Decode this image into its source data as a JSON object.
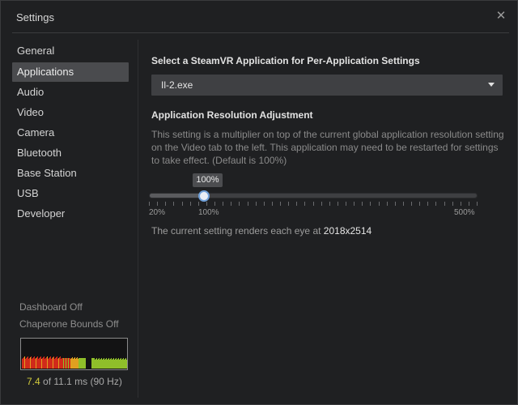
{
  "window": {
    "title": "Settings",
    "close_glyph": "✕"
  },
  "sidebar": {
    "items": [
      {
        "label": "General",
        "active": false
      },
      {
        "label": "Applications",
        "active": true
      },
      {
        "label": "Audio",
        "active": false
      },
      {
        "label": "Video",
        "active": false
      },
      {
        "label": "Camera",
        "active": false
      },
      {
        "label": "Bluetooth",
        "active": false
      },
      {
        "label": "Base Station",
        "active": false
      },
      {
        "label": "USB",
        "active": false
      },
      {
        "label": "Developer",
        "active": false
      }
    ]
  },
  "status": {
    "dashboard": "Dashboard Off",
    "chaperone": "Chaperone Bounds Off",
    "frame_time": "7.4",
    "frame_time_rest": " of 11.1 ms (90 Hz)"
  },
  "main": {
    "app_select_title": "Select a SteamVR Application for Per-Application Settings",
    "app_select_value": "Il-2.exe",
    "resolution_title": "Application Resolution Adjustment",
    "resolution_desc": "This setting is a multiplier on top of the current global application resolution setting on the Video tab to the left. This application may need to be restarted for settings to take effect. (Default is 100%)",
    "slider": {
      "value": 100,
      "min": 20,
      "max": 500,
      "tooltip": "100%",
      "label_min": "20%",
      "label_default": "100%",
      "label_max": "500%"
    },
    "render_prefix": "The current setting renders each eye at ",
    "render_value": "2018x2514"
  },
  "colors": {
    "accent": "#6f9fd8",
    "frame_ok": "#8fbf2a",
    "frame_bad": "#d12a1a",
    "frame_warn": "#e0a020"
  }
}
